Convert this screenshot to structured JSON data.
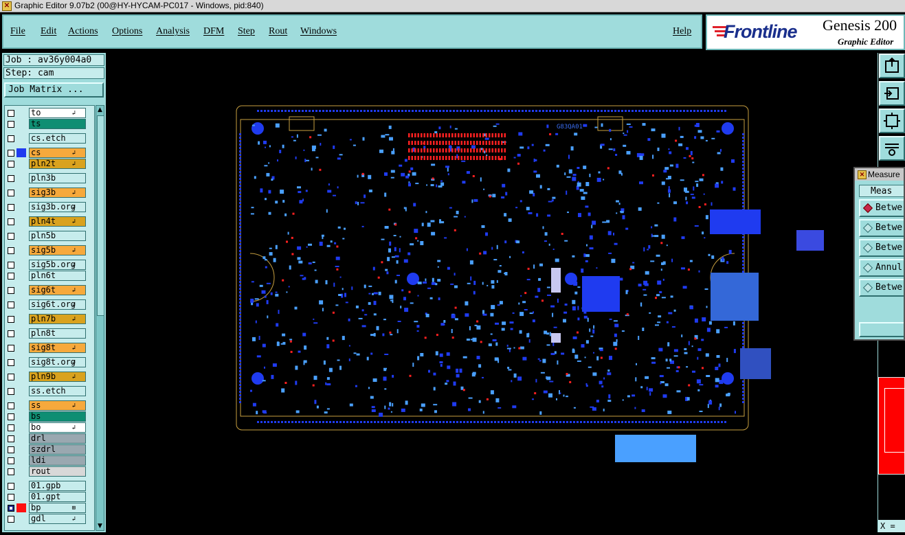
{
  "window": {
    "title": "Graphic Editor 9.07b2 (00@HY-HYCAM-PC017 - Windows, pid:840)"
  },
  "menu": {
    "items": [
      "File",
      "Edit",
      "Actions",
      "Options",
      "Analysis",
      "DFM",
      "Step",
      "Rout",
      "Windows"
    ],
    "help": "Help"
  },
  "brand": {
    "logo": "Frontline",
    "product": "Genesis 200",
    "subtitle": "Graphic Editor"
  },
  "job": {
    "job_line": "Job : av36y004a0",
    "step_line": "Step: cam",
    "matrix_button": "Job Matrix ..."
  },
  "layers": [
    {
      "name": "to",
      "color": "#ffffff",
      "swatch": "",
      "checked": false,
      "mark": "↲"
    },
    {
      "name": "ts",
      "color": "#0f8e73",
      "swatch": "",
      "checked": false,
      "mark": ""
    },
    {
      "name": "cs.etch",
      "color": "#c6ecec",
      "swatch": "",
      "checked": false,
      "mark": ""
    },
    {
      "name": "cs",
      "color": "#f6a93c",
      "swatch": "#1f3bf0",
      "checked": false,
      "mark": "↲"
    },
    {
      "name": "pln2t",
      "color": "#d9a21e",
      "swatch": "",
      "checked": false,
      "mark": "↲"
    },
    {
      "name": "pln3b",
      "color": "#c6ecec",
      "swatch": "",
      "checked": false,
      "mark": ""
    },
    {
      "name": "sig3b",
      "color": "#f6a93c",
      "swatch": "",
      "checked": false,
      "mark": "↲"
    },
    {
      "name": "sig3b.org",
      "color": "#c6ecec",
      "swatch": "",
      "checked": false,
      "mark": "↲"
    },
    {
      "name": "pln4t",
      "color": "#d9a21e",
      "swatch": "",
      "checked": false,
      "mark": "↲"
    },
    {
      "name": "pln5b",
      "color": "#c6ecec",
      "swatch": "",
      "checked": false,
      "mark": ""
    },
    {
      "name": "sig5b",
      "color": "#f6a93c",
      "swatch": "",
      "checked": false,
      "mark": "↲"
    },
    {
      "name": "sig5b.org",
      "color": "#c6ecec",
      "swatch": "",
      "checked": false,
      "mark": "↲"
    },
    {
      "name": "pln6t",
      "color": "#c6ecec",
      "swatch": "",
      "checked": false,
      "mark": ""
    },
    {
      "name": "sig6t",
      "color": "#f6a93c",
      "swatch": "",
      "checked": false,
      "mark": "↲"
    },
    {
      "name": "sig6t.org",
      "color": "#c6ecec",
      "swatch": "",
      "checked": false,
      "mark": "↲"
    },
    {
      "name": "pln7b",
      "color": "#d9a21e",
      "swatch": "",
      "checked": false,
      "mark": "↲"
    },
    {
      "name": "pln8t",
      "color": "#c6ecec",
      "swatch": "",
      "checked": false,
      "mark": ""
    },
    {
      "name": "sig8t",
      "color": "#f6a93c",
      "swatch": "",
      "checked": false,
      "mark": "↲"
    },
    {
      "name": "sig8t.org",
      "color": "#c6ecec",
      "swatch": "",
      "checked": false,
      "mark": "↲"
    },
    {
      "name": "pln9b",
      "color": "#d9a21e",
      "swatch": "",
      "checked": false,
      "mark": "↲"
    },
    {
      "name": "ss.etch",
      "color": "#c6ecec",
      "swatch": "",
      "checked": false,
      "mark": ""
    },
    {
      "name": "ss",
      "color": "#f6a93c",
      "swatch": "",
      "checked": false,
      "mark": "↲"
    },
    {
      "name": "bs",
      "color": "#0f8e73",
      "swatch": "",
      "checked": false,
      "mark": ""
    },
    {
      "name": "bo",
      "color": "#ffffff",
      "swatch": "",
      "checked": false,
      "mark": "↲"
    },
    {
      "name": "drl",
      "color": "#9aa8b0",
      "swatch": "",
      "checked": false,
      "mark": ""
    },
    {
      "name": "szdrl",
      "color": "#9aa8b0",
      "swatch": "",
      "checked": false,
      "mark": ""
    },
    {
      "name": "ldi",
      "color": "#9aa8b0",
      "swatch": "",
      "checked": false,
      "mark": ""
    },
    {
      "name": "rout",
      "color": "#d8d8d8",
      "swatch": "",
      "checked": false,
      "mark": ""
    },
    {
      "name": "01.gpb",
      "color": "#c6ecec",
      "swatch": "",
      "checked": false,
      "mark": ""
    },
    {
      "name": "01.gpt",
      "color": "#c6ecec",
      "swatch": "",
      "checked": false,
      "mark": ""
    },
    {
      "name": "bp",
      "color": "#c6ecec",
      "swatch": "#ff1010",
      "checked": true,
      "mark": "⊞"
    },
    {
      "name": "gdl",
      "color": "#c6ecec",
      "swatch": "",
      "checked": false,
      "mark": "↲"
    }
  ],
  "measure": {
    "title": "Measure",
    "header": "Meas",
    "options": [
      "Betwe",
      "Betwe",
      "Betwe",
      "Annul",
      "Betwe"
    ],
    "selected": 0
  },
  "board": {
    "label": "G83QA01"
  },
  "coord": {
    "text": "X ="
  },
  "colors": {
    "panel": "#9fdcdc",
    "field": "#c6ecec",
    "board_outline": "#c8a040",
    "copper": "#1f3bf0",
    "pads": "#4aa0ff",
    "highlight": "#ff2020"
  }
}
